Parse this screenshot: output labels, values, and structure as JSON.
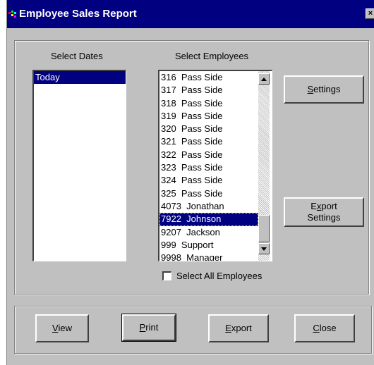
{
  "window": {
    "title": "Employee Sales Report",
    "close_glyph": "×"
  },
  "dates": {
    "label": "Select Dates",
    "items": [
      {
        "text": "Today",
        "selected": true
      }
    ]
  },
  "employees": {
    "label": "Select Employees",
    "items": [
      {
        "text": "316  Pass Side",
        "selected": false
      },
      {
        "text": "317  Pass Side",
        "selected": false
      },
      {
        "text": "318  Pass Side",
        "selected": false
      },
      {
        "text": "319  Pass Side",
        "selected": false
      },
      {
        "text": "320  Pass Side",
        "selected": false
      },
      {
        "text": "321  Pass Side",
        "selected": false
      },
      {
        "text": "322  Pass Side",
        "selected": false
      },
      {
        "text": "323  Pass Side",
        "selected": false
      },
      {
        "text": "324  Pass Side",
        "selected": false
      },
      {
        "text": "325  Pass Side",
        "selected": false
      },
      {
        "text": "4073  Jonathan",
        "selected": false
      },
      {
        "text": "7922  Johnson",
        "selected": true
      },
      {
        "text": "9207  Jackson",
        "selected": false
      },
      {
        "text": "999  Support",
        "selected": false
      },
      {
        "text": "9998  Manager",
        "selected": false
      }
    ],
    "select_all_label": "Select All Employees",
    "select_all_checked": false
  },
  "buttons": {
    "settings": "Settings",
    "export_settings_line1": "Export",
    "export_settings_line2": "Settings",
    "view": "View",
    "print": "Print",
    "export": "Export",
    "close": "Close"
  }
}
